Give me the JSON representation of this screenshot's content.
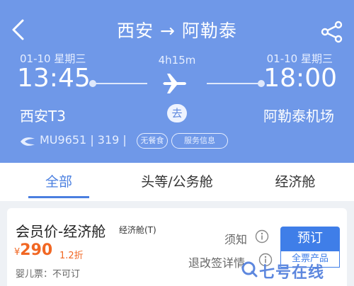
{
  "header": {
    "route_title": "西安 → 阿勒泰",
    "departure": {
      "date": "01-10 星期三",
      "time": "13:45",
      "airport": "西安T3"
    },
    "arrival": {
      "date": "01-10 星期三",
      "time": "18:00",
      "airport": "阿勒泰机场"
    },
    "duration": "4h15m",
    "direction_badge": "去",
    "flight_info": "MU9651 | 319 |",
    "tags": {
      "meal": "无餐食",
      "service": "服务信息"
    },
    "background_color": "#6f98e8"
  },
  "tabs": [
    {
      "label": "全部",
      "active": true
    },
    {
      "label": "头等/公务舱",
      "active": false
    },
    {
      "label": "经济舱",
      "active": false
    }
  ],
  "fare_card": {
    "name": "会员价-经济舱",
    "cabin_class": "经济舱(T)",
    "currency": "¥",
    "price": "290",
    "discount": "1.2折",
    "infant_ticket": "婴儿票：不可订",
    "notice_label": "须知",
    "refund_label": "退改签详情",
    "book_label": "预订",
    "book_sub_label": "全票产品"
  },
  "watermark": {
    "text": "七号在线"
  },
  "colors": {
    "accent": "#4a7fe0",
    "price": "#f16723"
  }
}
